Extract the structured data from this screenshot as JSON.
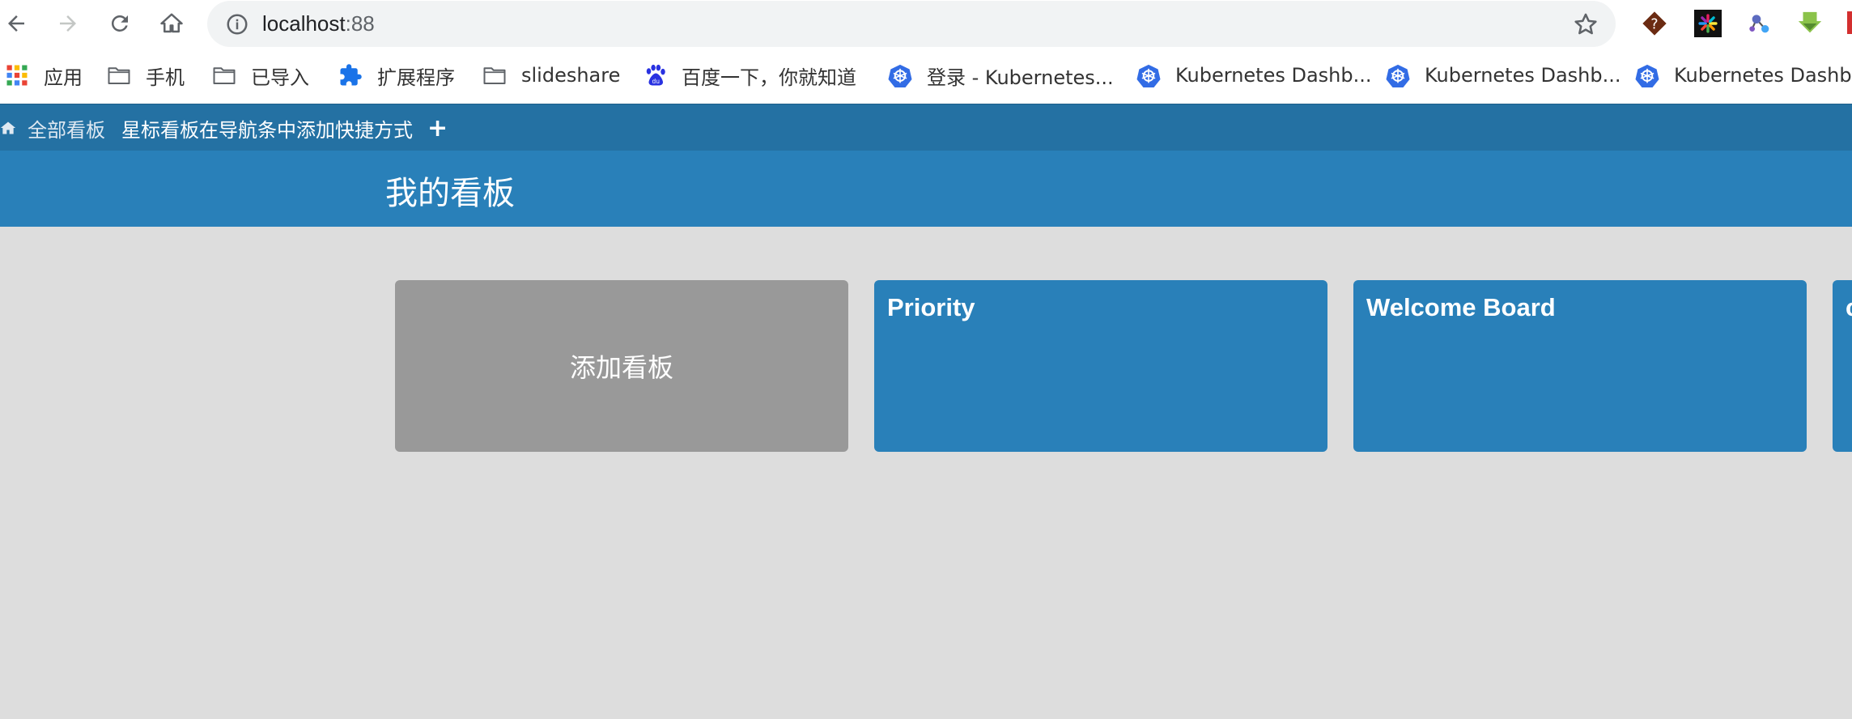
{
  "browser": {
    "url_host": "localhost",
    "url_port": ":88",
    "extensions": [
      "diamond-extension-icon",
      "colorwheel-extension-icon",
      "molecule-extension-icon",
      "download-arrow-extension-icon"
    ]
  },
  "bookmarks": [
    {
      "label": "应用",
      "icon": "apps-grid-icon"
    },
    {
      "label": "手机",
      "icon": "folder-icon"
    },
    {
      "label": "已导入",
      "icon": "folder-icon"
    },
    {
      "label": "扩展程序",
      "icon": "puzzle-icon"
    },
    {
      "label": "slideshare",
      "icon": "folder-icon"
    },
    {
      "label": "百度一下，你就知道",
      "icon": "baidu-paw-icon"
    },
    {
      "label": "登录 - Kubernetes...",
      "icon": "kubernetes-icon"
    },
    {
      "label": "Kubernetes Dashb...",
      "icon": "kubernetes-icon"
    },
    {
      "label": "Kubernetes Dashb...",
      "icon": "kubernetes-icon"
    },
    {
      "label": "Kubernetes Dashb...",
      "icon": "kubernetes-icon"
    }
  ],
  "appnav": {
    "all_boards": "全部看板",
    "star_hint": "星标看板在导航条中添加快捷方式",
    "add": "+"
  },
  "header": {
    "title": "我的看板"
  },
  "boards": {
    "add_label": "添加看板",
    "items": [
      {
        "name": "Priority"
      },
      {
        "name": "Welcome Board"
      },
      {
        "name": "c"
      }
    ]
  },
  "colors": {
    "nav_bg": "#2471a3",
    "header_bg": "#2980b9",
    "board_bg": "#2980b9",
    "add_board_bg": "#999999",
    "page_bg": "#dddddd"
  }
}
